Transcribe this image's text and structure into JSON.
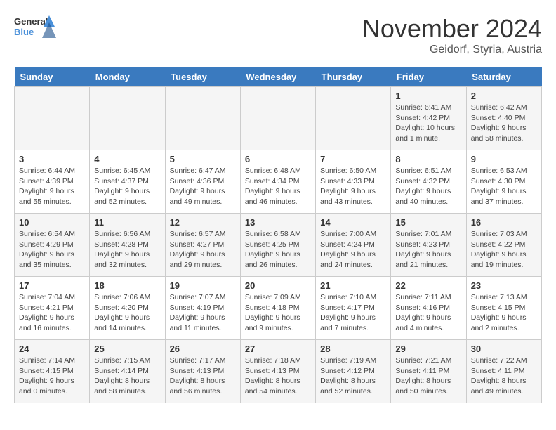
{
  "logo": {
    "line1": "General",
    "line2": "Blue"
  },
  "title": "November 2024",
  "subtitle": "Geidorf, Styria, Austria",
  "days_header": [
    "Sunday",
    "Monday",
    "Tuesday",
    "Wednesday",
    "Thursday",
    "Friday",
    "Saturday"
  ],
  "weeks": [
    [
      {
        "num": "",
        "info": ""
      },
      {
        "num": "",
        "info": ""
      },
      {
        "num": "",
        "info": ""
      },
      {
        "num": "",
        "info": ""
      },
      {
        "num": "",
        "info": ""
      },
      {
        "num": "1",
        "info": "Sunrise: 6:41 AM\nSunset: 4:42 PM\nDaylight: 10 hours and 1 minute."
      },
      {
        "num": "2",
        "info": "Sunrise: 6:42 AM\nSunset: 4:40 PM\nDaylight: 9 hours and 58 minutes."
      }
    ],
    [
      {
        "num": "3",
        "info": "Sunrise: 6:44 AM\nSunset: 4:39 PM\nDaylight: 9 hours and 55 minutes."
      },
      {
        "num": "4",
        "info": "Sunrise: 6:45 AM\nSunset: 4:37 PM\nDaylight: 9 hours and 52 minutes."
      },
      {
        "num": "5",
        "info": "Sunrise: 6:47 AM\nSunset: 4:36 PM\nDaylight: 9 hours and 49 minutes."
      },
      {
        "num": "6",
        "info": "Sunrise: 6:48 AM\nSunset: 4:34 PM\nDaylight: 9 hours and 46 minutes."
      },
      {
        "num": "7",
        "info": "Sunrise: 6:50 AM\nSunset: 4:33 PM\nDaylight: 9 hours and 43 minutes."
      },
      {
        "num": "8",
        "info": "Sunrise: 6:51 AM\nSunset: 4:32 PM\nDaylight: 9 hours and 40 minutes."
      },
      {
        "num": "9",
        "info": "Sunrise: 6:53 AM\nSunset: 4:30 PM\nDaylight: 9 hours and 37 minutes."
      }
    ],
    [
      {
        "num": "10",
        "info": "Sunrise: 6:54 AM\nSunset: 4:29 PM\nDaylight: 9 hours and 35 minutes."
      },
      {
        "num": "11",
        "info": "Sunrise: 6:56 AM\nSunset: 4:28 PM\nDaylight: 9 hours and 32 minutes."
      },
      {
        "num": "12",
        "info": "Sunrise: 6:57 AM\nSunset: 4:27 PM\nDaylight: 9 hours and 29 minutes."
      },
      {
        "num": "13",
        "info": "Sunrise: 6:58 AM\nSunset: 4:25 PM\nDaylight: 9 hours and 26 minutes."
      },
      {
        "num": "14",
        "info": "Sunrise: 7:00 AM\nSunset: 4:24 PM\nDaylight: 9 hours and 24 minutes."
      },
      {
        "num": "15",
        "info": "Sunrise: 7:01 AM\nSunset: 4:23 PM\nDaylight: 9 hours and 21 minutes."
      },
      {
        "num": "16",
        "info": "Sunrise: 7:03 AM\nSunset: 4:22 PM\nDaylight: 9 hours and 19 minutes."
      }
    ],
    [
      {
        "num": "17",
        "info": "Sunrise: 7:04 AM\nSunset: 4:21 PM\nDaylight: 9 hours and 16 minutes."
      },
      {
        "num": "18",
        "info": "Sunrise: 7:06 AM\nSunset: 4:20 PM\nDaylight: 9 hours and 14 minutes."
      },
      {
        "num": "19",
        "info": "Sunrise: 7:07 AM\nSunset: 4:19 PM\nDaylight: 9 hours and 11 minutes."
      },
      {
        "num": "20",
        "info": "Sunrise: 7:09 AM\nSunset: 4:18 PM\nDaylight: 9 hours and 9 minutes."
      },
      {
        "num": "21",
        "info": "Sunrise: 7:10 AM\nSunset: 4:17 PM\nDaylight: 9 hours and 7 minutes."
      },
      {
        "num": "22",
        "info": "Sunrise: 7:11 AM\nSunset: 4:16 PM\nDaylight: 9 hours and 4 minutes."
      },
      {
        "num": "23",
        "info": "Sunrise: 7:13 AM\nSunset: 4:15 PM\nDaylight: 9 hours and 2 minutes."
      }
    ],
    [
      {
        "num": "24",
        "info": "Sunrise: 7:14 AM\nSunset: 4:15 PM\nDaylight: 9 hours and 0 minutes."
      },
      {
        "num": "25",
        "info": "Sunrise: 7:15 AM\nSunset: 4:14 PM\nDaylight: 8 hours and 58 minutes."
      },
      {
        "num": "26",
        "info": "Sunrise: 7:17 AM\nSunset: 4:13 PM\nDaylight: 8 hours and 56 minutes."
      },
      {
        "num": "27",
        "info": "Sunrise: 7:18 AM\nSunset: 4:13 PM\nDaylight: 8 hours and 54 minutes."
      },
      {
        "num": "28",
        "info": "Sunrise: 7:19 AM\nSunset: 4:12 PM\nDaylight: 8 hours and 52 minutes."
      },
      {
        "num": "29",
        "info": "Sunrise: 7:21 AM\nSunset: 4:11 PM\nDaylight: 8 hours and 50 minutes."
      },
      {
        "num": "30",
        "info": "Sunrise: 7:22 AM\nSunset: 4:11 PM\nDaylight: 8 hours and 49 minutes."
      }
    ]
  ]
}
